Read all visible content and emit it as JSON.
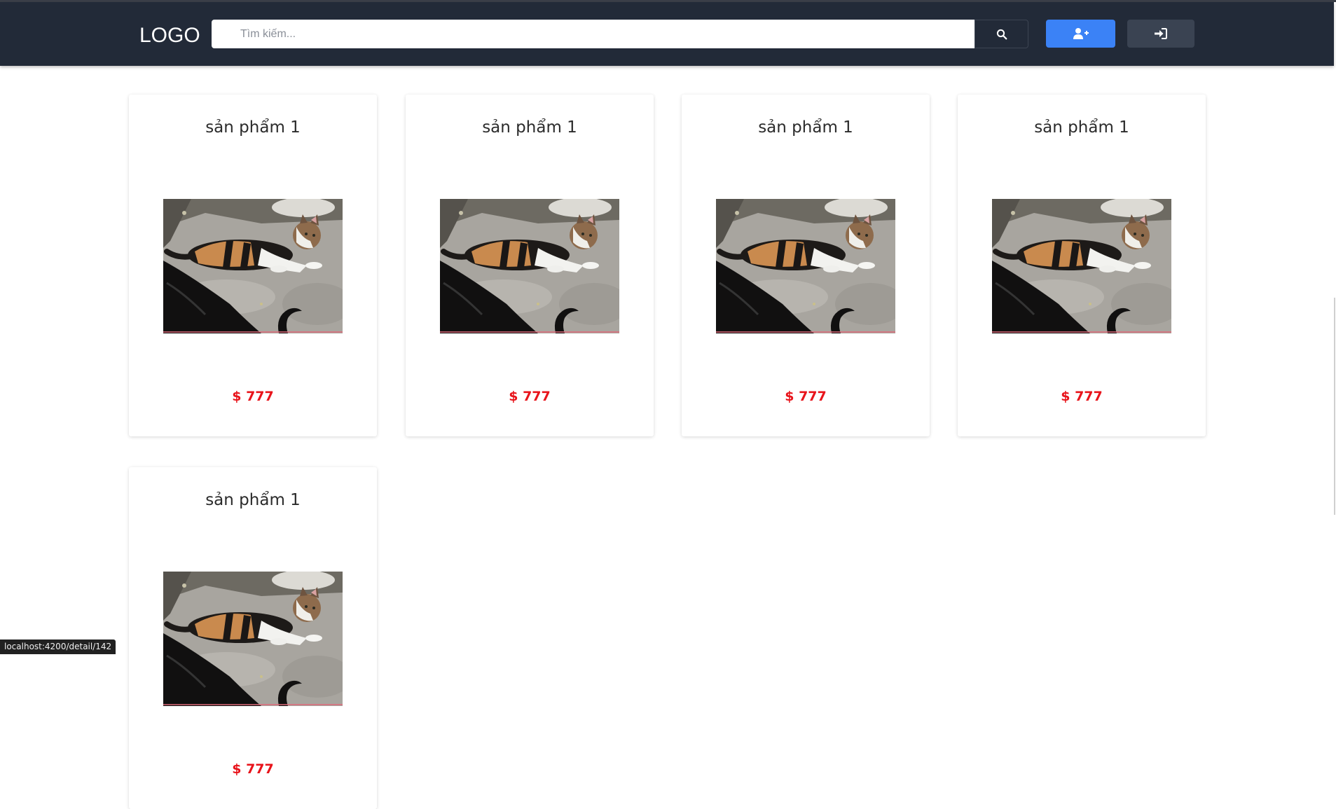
{
  "header": {
    "logo": "LOGO",
    "search_placeholder": "Tìm kiếm...",
    "search_icon": "search-icon",
    "register_icon": "user-plus-icon",
    "login_icon": "sign-in-icon",
    "colors": {
      "navbar": "#222a38",
      "register": "#3b82f6",
      "login": "#3a4352"
    }
  },
  "products": [
    {
      "name": "sản phẩm 1",
      "price": "$ 777"
    },
    {
      "name": "sản phẩm 1",
      "price": "$ 777"
    },
    {
      "name": "sản phẩm 1",
      "price": "$ 777"
    },
    {
      "name": "sản phẩm 1",
      "price": "$ 777"
    },
    {
      "name": "sản phẩm 1",
      "price": "$ 777"
    }
  ],
  "status_bar": {
    "url": "localhost:4200/detail/142"
  },
  "colors": {
    "price": "#e8141b"
  }
}
